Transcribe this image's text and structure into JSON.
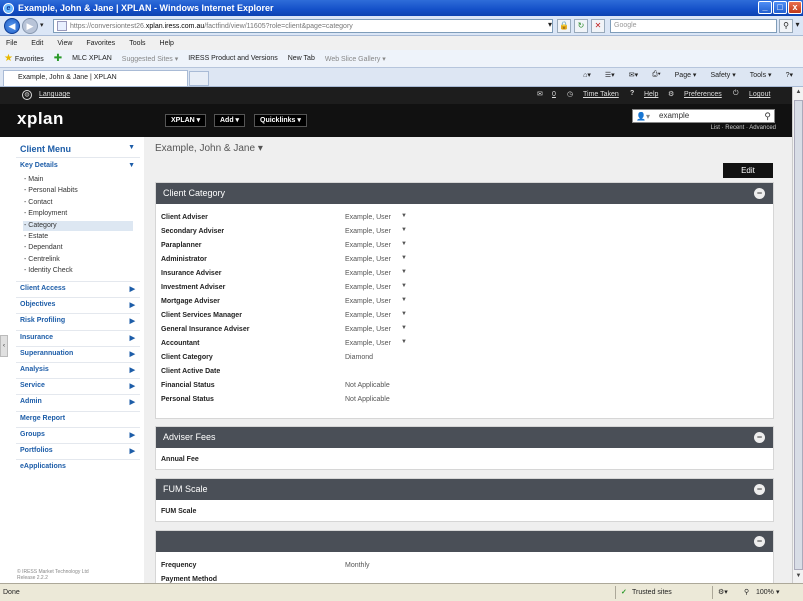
{
  "window": {
    "title": "Example, John & Jane | XPLAN - Windows Internet Explorer",
    "btn_min": "_",
    "btn_max": "□",
    "btn_close": "x"
  },
  "address": {
    "url_prefix": "https://conversiontest26.",
    "url_domain": "xplan.iress.com.au",
    "url_suffix": "/factfind/view/11605?role=client&page=category",
    "search_placeholder": "Google"
  },
  "menu": [
    "File",
    "Edit",
    "View",
    "Favorites",
    "Tools",
    "Help"
  ],
  "favorites": {
    "favorites_label": "Favorites",
    "items": [
      "MLC XPLAN",
      "Suggested Sites ▾",
      "IRESS Product and Versions",
      "New Tab",
      "Web Slice Gallery ▾"
    ]
  },
  "tabs": {
    "active": "Example, John & Jane | XPLAN"
  },
  "command_bar": [
    "Page ▾",
    "Safety ▾",
    "Tools ▾"
  ],
  "xplan_top": {
    "language": "Language",
    "mail_count": "0",
    "time_taken": "Time Taken",
    "help": "Help",
    "preferences": "Preferences",
    "logout": "Logout"
  },
  "xplan_header": {
    "logo": "xplan",
    "menus": [
      "XPLAN ▾",
      "Add ▾",
      "Quicklinks ▾"
    ],
    "search_value": "example",
    "search_links": "List · Recent · Advanced"
  },
  "sidebar": {
    "client_menu": "Client Menu",
    "key_details": "Key Details",
    "key_details_items": [
      "Main",
      "Personal Habits",
      "Contact",
      "Employment",
      "Category",
      "Estate",
      "Dependant",
      "Centrelink",
      "Identity Check"
    ],
    "active_item": "Category",
    "sections": [
      "Client Access",
      "Objectives",
      "Risk Profiling",
      "Insurance",
      "Superannuation",
      "Analysis",
      "Service",
      "Admin",
      "Merge Report",
      "Groups",
      "Portfolios",
      "eApplications"
    ],
    "footer_line1": "© IRESS Market Technology Ltd",
    "footer_line2": "Release 2.2.2"
  },
  "main": {
    "client_name": "Example, John & Jane ▾",
    "edit": "Edit",
    "client_category_title": "Client Category",
    "client_category_rows": [
      {
        "label": "Client Adviser",
        "value": "Example, User",
        "dropdown": true
      },
      {
        "label": "Secondary Adviser",
        "value": "Example, User",
        "dropdown": true
      },
      {
        "label": "Paraplanner",
        "value": "Example, User",
        "dropdown": true
      },
      {
        "label": "Administrator",
        "value": "Example, User",
        "dropdown": true
      },
      {
        "label": "Insurance Adviser",
        "value": "Example, User",
        "dropdown": true
      },
      {
        "label": "Investment Adviser",
        "value": "Example, User",
        "dropdown": true
      },
      {
        "label": "Mortgage Adviser",
        "value": "Example, User",
        "dropdown": true
      },
      {
        "label": "Client Services Manager",
        "value": "Example, User",
        "dropdown": true
      },
      {
        "label": "General Insurance Adviser",
        "value": "Example, User",
        "dropdown": true
      },
      {
        "label": "Accountant",
        "value": "Example, User",
        "dropdown": true
      },
      {
        "label": "Client Category",
        "value": "Diamond",
        "dropdown": false
      },
      {
        "label": "Client Active Date",
        "value": "",
        "dropdown": false
      },
      {
        "label": "Financial Status",
        "value": "Not Applicable",
        "dropdown": false
      },
      {
        "label": "Personal Status",
        "value": "Not Applicable",
        "dropdown": false
      }
    ],
    "adviser_fees_title": "Adviser Fees",
    "annual_fee": "Annual Fee",
    "fum_scale_title": "FUM Scale",
    "fum_scale": "FUM Scale",
    "blank_panel_title": "",
    "frequency_label": "Frequency",
    "frequency_value": "Monthly",
    "payment_method": "Payment Method",
    "collapse_glyph": "−"
  },
  "status": {
    "left": "Done",
    "zone": "Trusted sites",
    "zoom": "100%"
  }
}
